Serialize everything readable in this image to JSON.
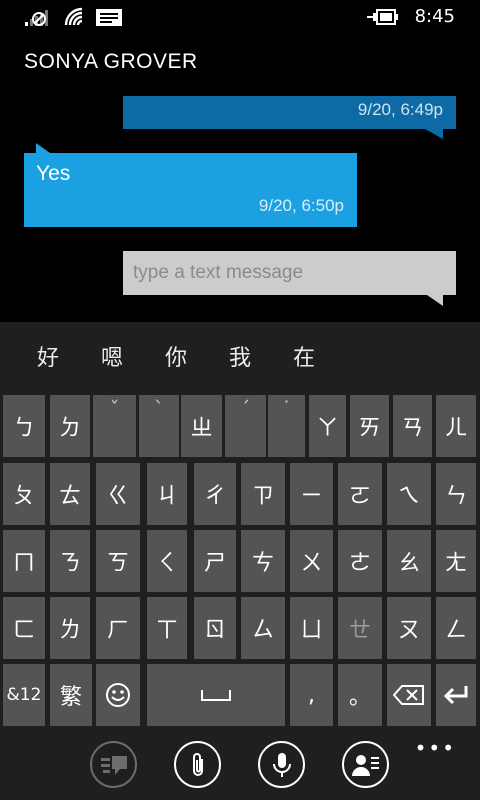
{
  "status": {
    "time": "8:45"
  },
  "conversation": {
    "contact_name": "SONYA GROVER",
    "messages": [
      {
        "direction": "sent",
        "text": "",
        "timestamp": "9/20, 6:49p"
      },
      {
        "direction": "received",
        "text": "Yes",
        "timestamp": "9/20, 6:50p"
      }
    ],
    "composer_placeholder": "type a text message"
  },
  "keyboard": {
    "suggestions": [
      "好",
      "嗯",
      "你",
      "我",
      "在"
    ],
    "row1": [
      "ㄅ",
      "ㄉ",
      "ˇ",
      "ˋ",
      "ㄓ",
      "ˊ",
      "˙",
      "ㄚ",
      "ㄞ",
      "ㄢ",
      "ㄦ"
    ],
    "row2": [
      "ㄆ",
      "ㄊ",
      "ㄍ",
      "ㄐ",
      "ㄔ",
      "ㄗ",
      "ㄧ",
      "ㄛ",
      "ㄟ",
      "ㄣ"
    ],
    "row3": [
      "ㄇ",
      "ㄋ",
      "ㄎ",
      "ㄑ",
      "ㄕ",
      "ㄘ",
      "ㄨ",
      "ㄜ",
      "ㄠ",
      "ㄤ"
    ],
    "row4": [
      "ㄈ",
      "ㄌ",
      "ㄏ",
      "ㄒ",
      "ㄖ",
      "ㄙ",
      "ㄩ",
      "ㄝ",
      "ㄡ",
      "ㄥ"
    ],
    "row5": {
      "symbols": "&12",
      "traditional": "繁",
      "comma": ",",
      "period": "。"
    }
  },
  "icons": {
    "signal": "signal-icon",
    "wifi": "wifi-icon",
    "notification": "message-notification-icon",
    "battery": "battery-charging-icon",
    "emoji": "emoji-icon",
    "space": "space-icon",
    "backspace": "backspace-icon",
    "enter": "enter-icon",
    "switch": "switch-conversation-icon",
    "attach": "attach-icon",
    "voice": "microphone-icon",
    "contact": "contact-card-icon"
  },
  "colors": {
    "sent_bubble": "#0e6aa5",
    "received_bubble": "#1ba1e2",
    "composer": "#cccccc",
    "key": "#545454",
    "keyboard_bg": "#1f1f1f"
  }
}
